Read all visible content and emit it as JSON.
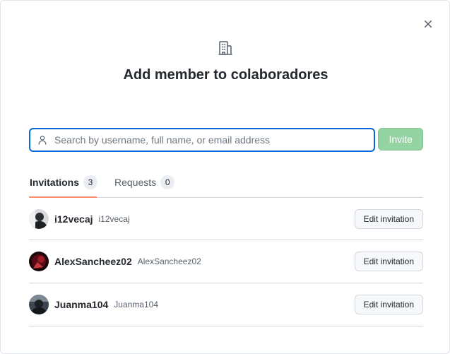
{
  "dialog": {
    "title": "Add member to colaboradores",
    "icons": {
      "close": "close-icon",
      "organization": "organization-icon"
    }
  },
  "search": {
    "placeholder": "Search by username, full name, or email address",
    "value": "",
    "icon": "person-icon",
    "invite_label": "Invite"
  },
  "tabs": [
    {
      "label": "Invitations",
      "count": "3",
      "selected": true
    },
    {
      "label": "Requests",
      "count": "0",
      "selected": false
    }
  ],
  "invitations": [
    {
      "username": "i12vecaj",
      "fullname": "i12vecaj",
      "action": "Edit invitation"
    },
    {
      "username": "AlexSancheez02",
      "fullname": "AlexSancheez02",
      "action": "Edit invitation"
    },
    {
      "username": "Juanma104",
      "fullname": "Juanma104",
      "action": "Edit invitation"
    }
  ],
  "colors": {
    "focus_blue": "#0969da",
    "invite_green_disabled": "#94d3a2",
    "tab_underline": "#fd8c73"
  }
}
